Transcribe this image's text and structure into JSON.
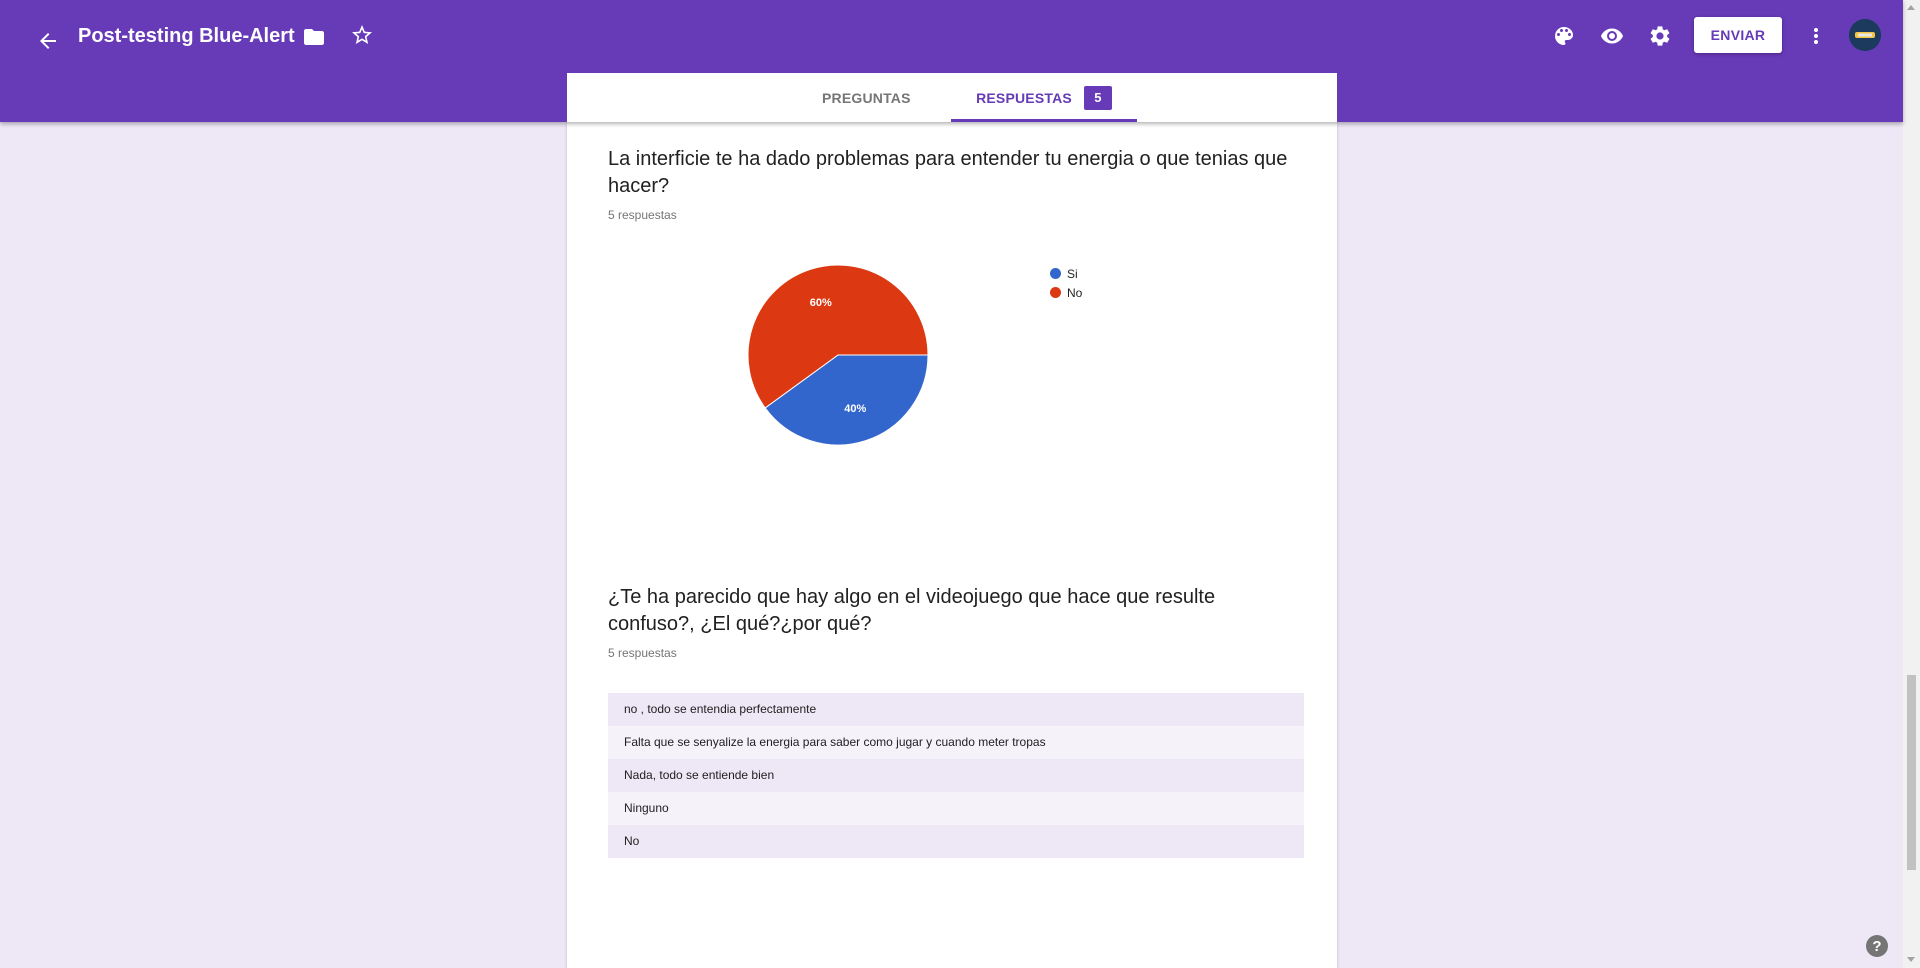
{
  "header": {
    "form_title": "Post-testing Blue-Alert",
    "send_label": "ENVIAR",
    "icons": [
      "back-arrow-icon",
      "folder-icon",
      "star-icon",
      "palette-icon",
      "preview-eye-icon",
      "settings-gear-icon",
      "more-vert-icon",
      "avatar"
    ]
  },
  "tabs": {
    "questions_label": "PREGUNTAS",
    "responses_label": "RESPUESTAS",
    "responses_count": "5"
  },
  "questions": [
    {
      "title": "La interficie te ha dado problemas para entender tu energia o que tenias que hacer?",
      "response_count": "5 respuestas"
    },
    {
      "title": "¿Te ha parecido que hay algo en el videojuego que hace que resulte confuso?, ¿El qué?¿por qué?",
      "response_count": "5 respuestas",
      "answers": [
        "no , todo se entendia perfectamente",
        "Falta que se senyalize la energia para saber como jugar y cuando meter tropas",
        "Nada, todo se entiende bien",
        "Ninguno",
        "No"
      ]
    }
  ],
  "chart_data": {
    "type": "pie",
    "categories": [
      "Si",
      "No"
    ],
    "values": [
      40,
      60
    ],
    "labels": [
      "40%",
      "60%"
    ],
    "colors": [
      "#3366cc",
      "#dc3912"
    ],
    "legend": "right"
  },
  "colors": {
    "brand": "#673ab7",
    "background": "#ede7f6"
  },
  "help_label": "?"
}
